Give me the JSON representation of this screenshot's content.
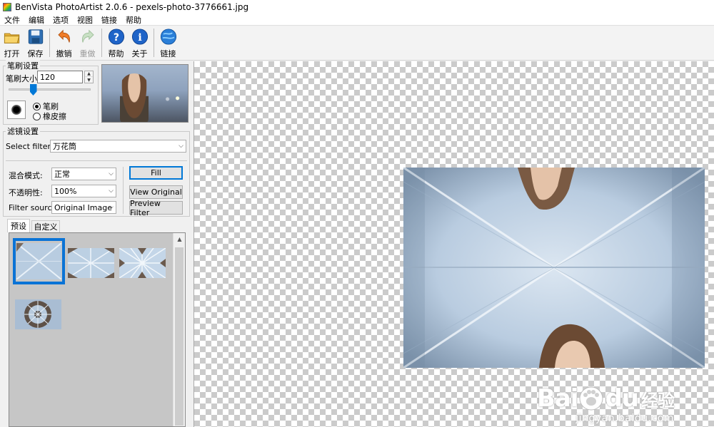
{
  "window": {
    "title": "BenVista PhotoArtist 2.0.6 - pexels-photo-3776661.jpg"
  },
  "menu": [
    "文件",
    "编辑",
    "选项",
    "视图",
    "链接",
    "帮助"
  ],
  "toolbar": {
    "open": "打开",
    "save": "保存",
    "undo": "撤销",
    "redo": "重做",
    "help": "帮助",
    "about": "关于",
    "link": "链接"
  },
  "brush": {
    "group_title": "笔刷设置",
    "size_label": "笔刷大小:",
    "size_value": "120",
    "size_fraction": 0.3,
    "mode_brush": "笔刷",
    "mode_eraser": "橡皮擦"
  },
  "filter": {
    "group_title": "滤镜设置",
    "select_label": "Select filter:",
    "select_value": "万花筒",
    "blend_label": "混合模式:",
    "blend_value": "正常",
    "opacity_label": "不透明性:",
    "opacity_value": "100%",
    "source_label": "Filter source:",
    "source_value": "Original Image",
    "fill_button": "Fill",
    "view_original_button": "View Original",
    "preview_button": "Preview Filter"
  },
  "tabs": {
    "preset": "预设",
    "custom": "自定义"
  },
  "watermark": {
    "brand": "Bai",
    "brand2": "du",
    "cn": "经验",
    "url": "jingyan.baidu.com"
  },
  "colors": {
    "accent": "#0a73d6",
    "button_default_border": "#0078d7"
  }
}
